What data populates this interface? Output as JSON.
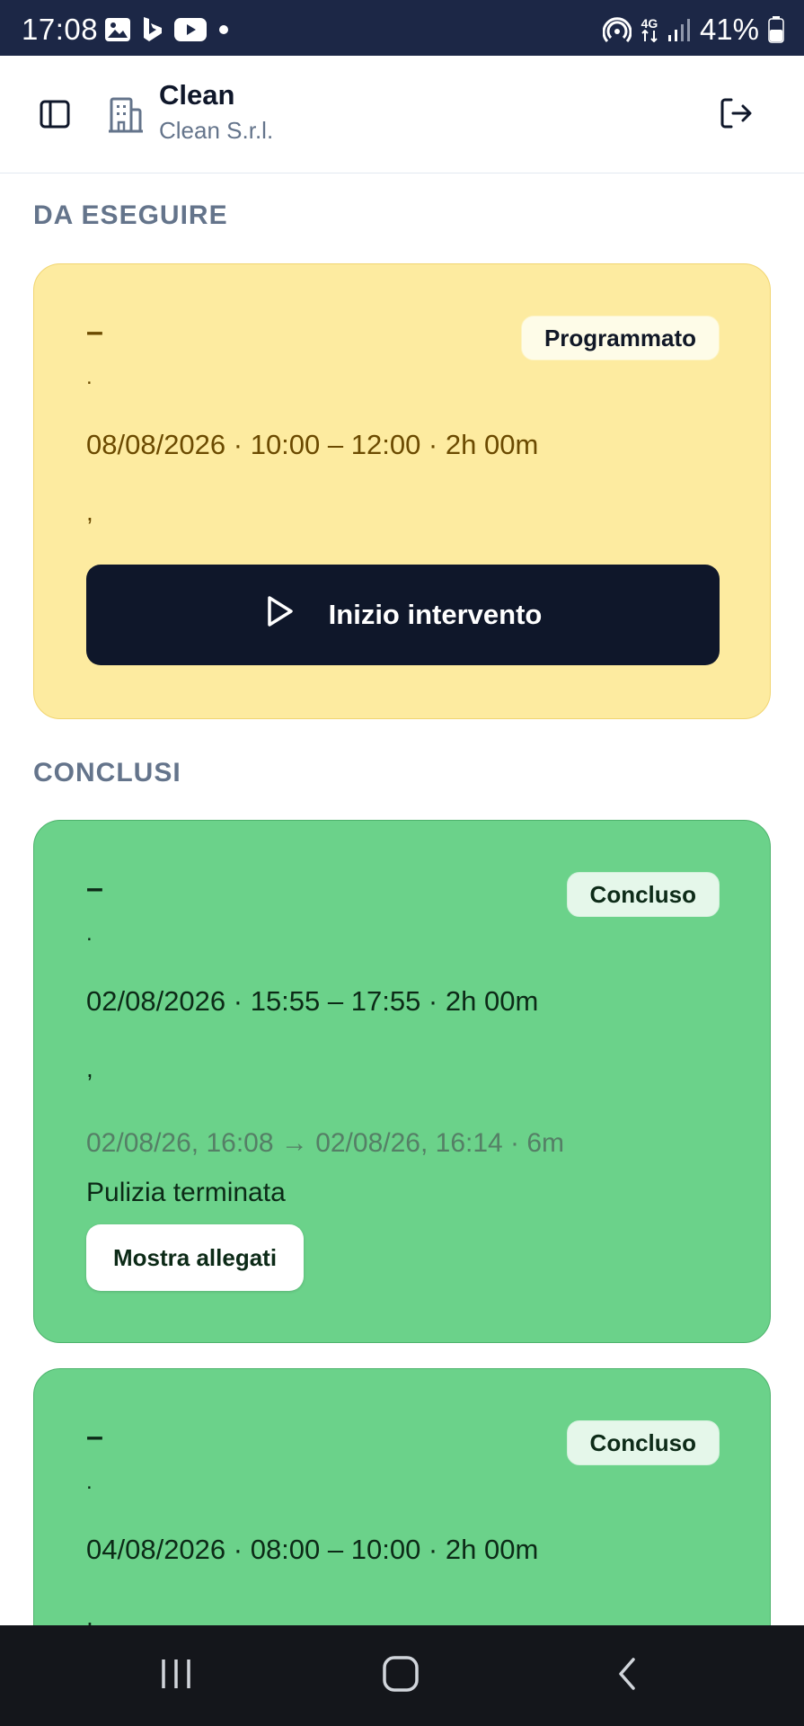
{
  "status_bar": {
    "time": "17:08",
    "battery": "41%",
    "network": "4G",
    "left_icons": [
      "gallery-icon",
      "bing-icon",
      "youtube-icon",
      "dot-icon"
    ],
    "right_icons": [
      "hotspot-icon",
      "network-4g-icon",
      "signal-icon",
      "battery-icon"
    ]
  },
  "header": {
    "org_name": "Clean",
    "org_subtitle": "Clean S.r.l.",
    "icons": [
      "sidebar-toggle-icon",
      "building-icon",
      "logout-icon"
    ]
  },
  "sections": {
    "todo_title": "DA ESEGUIRE",
    "done_title": "CONCLUSI"
  },
  "todo_cards": [
    {
      "title": "–",
      "subtitle": ".",
      "when": "08/08/2026 · 10:00 – 12:00 · 2h 00m",
      "location": ",",
      "status": "Programmato",
      "action_label": "Inizio intervento"
    }
  ],
  "done_cards": [
    {
      "title": "–",
      "subtitle": ".",
      "when": "02/08/2026 · 15:55 – 17:55 · 2h 00m",
      "location": ",",
      "status": "Concluso",
      "executed": "02/08/26, 16:08 → 02/08/26, 16:14 · 6m",
      "note": "Pulizia terminata",
      "attachments_label": "Mostra allegati"
    },
    {
      "title": "–",
      "subtitle": ".",
      "when": "04/08/2026 · 08:00 – 10:00 · 2h 00m",
      "location": ",",
      "status": "Concluso"
    }
  ],
  "colors": {
    "status_bar": "#1c2746",
    "todo_card": "#fdeba0",
    "done_card": "#6bd28a",
    "primary_button": "#0f172a",
    "section_title": "#64748b",
    "nav_bar": "#14161b"
  },
  "nav_bar": [
    "recents-icon",
    "home-icon",
    "back-icon"
  ]
}
